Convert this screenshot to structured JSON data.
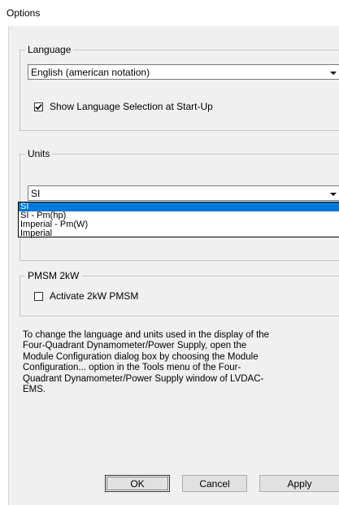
{
  "window": {
    "title": "Options"
  },
  "language_group": {
    "legend": "Language",
    "selected": "English (american notation)",
    "show_at_startup_label": "Show Language Selection at Start-Up",
    "show_at_startup_checked": true
  },
  "units_group": {
    "legend": "Units",
    "selected": "SI",
    "options": [
      "SI",
      "SI - Pm(hp)",
      "Imperial - Pm(W)",
      "Imperial"
    ],
    "highlighted_index": 0
  },
  "pmsm_group": {
    "legend": "PMSM 2kW",
    "activate_label": "Activate 2kW PMSM",
    "activate_checked": false
  },
  "info_lines": [
    "To change the language and units used in the display of the",
    "Four-Quadrant Dynamometer/Power Supply, open the",
    "Module Configuration dialog box by choosing the Module",
    "Configuration... option in the Tools menu of the Four-",
    "Quadrant Dynamometer/Power Supply window of LVDAC-",
    "EMS."
  ],
  "buttons": {
    "ok": "OK",
    "cancel": "Cancel",
    "apply": "Apply"
  }
}
